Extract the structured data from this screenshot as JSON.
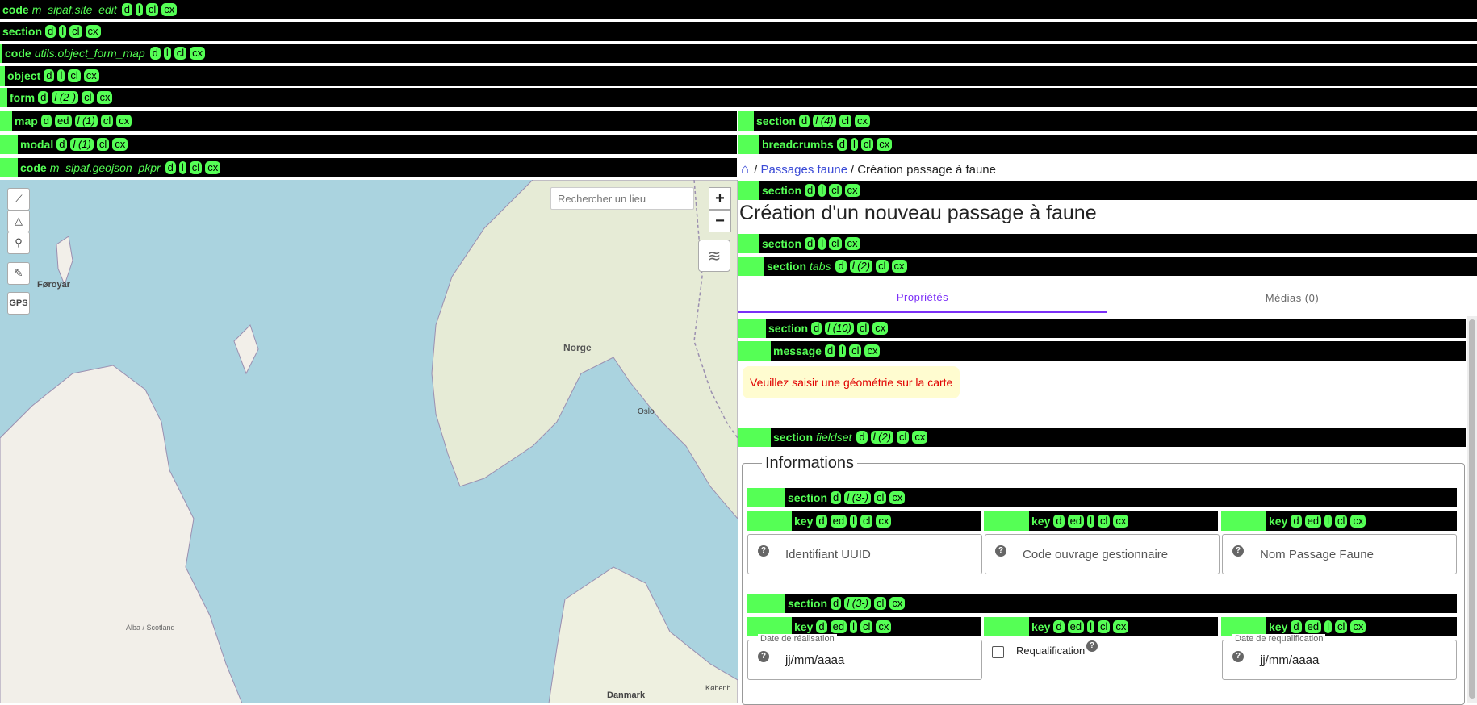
{
  "bars": {
    "code_site": {
      "tag": "code",
      "name": "m_sipaf.site_edit",
      "pills": [
        "d",
        "l",
        "cl",
        "cx"
      ]
    },
    "section1": {
      "tag": "section",
      "name": "",
      "pills": [
        "d",
        "l",
        "cl",
        "cx"
      ]
    },
    "code_utils": {
      "tag": "code",
      "name": "utils.object_form_map",
      "pills": [
        "d",
        "l",
        "cl",
        "cx"
      ]
    },
    "object": {
      "tag": "object",
      "name": "",
      "pills": [
        "d",
        "l",
        "cl",
        "cx"
      ]
    },
    "form": {
      "tag": "form",
      "name": "",
      "pills": [
        "d",
        "l (2-)",
        "cl",
        "cx"
      ]
    },
    "map": {
      "tag": "map",
      "name": "",
      "pills": [
        "d",
        "ed",
        "l (1)",
        "cl",
        "cx"
      ]
    },
    "modal": {
      "tag": "modal",
      "name": "",
      "pills": [
        "d",
        "l (1)",
        "cl",
        "cx"
      ]
    },
    "code_geojson": {
      "tag": "code",
      "name": "m_sipaf.geojson_pkpr",
      "pills": [
        "d",
        "l",
        "cl",
        "cx"
      ]
    },
    "section_right": {
      "tag": "section",
      "name": "",
      "pills": [
        "d",
        "l (4)",
        "cl",
        "cx"
      ]
    },
    "breadcrumbs": {
      "tag": "breadcrumbs",
      "name": "",
      "pills": [
        "d",
        "l",
        "cl",
        "cx"
      ]
    },
    "section_title": {
      "tag": "section",
      "name": "",
      "pills": [
        "d",
        "l",
        "cl",
        "cx"
      ]
    },
    "section_tabs_wrap": {
      "tag": "section",
      "name": "",
      "pills": [
        "d",
        "l",
        "cl",
        "cx"
      ]
    },
    "section_tabs": {
      "tag": "section",
      "name": "tabs",
      "pills": [
        "d",
        "l (2)",
        "cl",
        "cx"
      ]
    },
    "section_10": {
      "tag": "section",
      "name": "",
      "pills": [
        "d",
        "l (10)",
        "cl",
        "cx"
      ]
    },
    "message": {
      "tag": "message",
      "name": "",
      "pills": [
        "d",
        "l",
        "cl",
        "cx"
      ]
    },
    "section_fieldset": {
      "tag": "section",
      "name": "fieldset",
      "pills": [
        "d",
        "l (2)",
        "cl",
        "cx"
      ]
    },
    "section_row1": {
      "tag": "section",
      "name": "",
      "pills": [
        "d",
        "l (3-)",
        "cl",
        "cx"
      ]
    },
    "key_r1_1": {
      "tag": "key",
      "name": "",
      "pills": [
        "d",
        "ed",
        "l",
        "cl",
        "cx"
      ]
    },
    "key_r1_2": {
      "tag": "key",
      "name": "",
      "pills": [
        "d",
        "ed",
        "l",
        "cl",
        "cx"
      ]
    },
    "key_r1_3": {
      "tag": "key",
      "name": "",
      "pills": [
        "d",
        "ed",
        "l",
        "cl",
        "cx"
      ]
    },
    "section_row2": {
      "tag": "section",
      "name": "",
      "pills": [
        "d",
        "l (3-)",
        "cl",
        "cx"
      ]
    },
    "key_r2_1": {
      "tag": "key",
      "name": "",
      "pills": [
        "d",
        "ed",
        "l",
        "cl",
        "cx"
      ]
    },
    "key_r2_2": {
      "tag": "key",
      "name": "",
      "pills": [
        "d",
        "ed",
        "l",
        "cl",
        "cx"
      ]
    },
    "key_r2_3": {
      "tag": "key",
      "name": "",
      "pills": [
        "d",
        "ed",
        "l",
        "cl",
        "cx"
      ]
    }
  },
  "map": {
    "search_placeholder": "Rechercher un lieu",
    "zoom_in": "+",
    "zoom_out": "−",
    "gps_label": "GPS",
    "labels": {
      "foroyar": "Føroyar",
      "norge": "Norge",
      "oslo": "Oslo",
      "scotland": "Alba / Scotland",
      "danmark": "Danmark",
      "kobenhavn": "Københ"
    }
  },
  "breadcrumb": {
    "link": "Passages faune",
    "separator": "/",
    "current": "Création passage à faune"
  },
  "page_title": "Création d'un nouveau passage à faune",
  "tabs": [
    {
      "label": "Propriétés",
      "active": true
    },
    {
      "label": "Médias (0)",
      "active": false
    }
  ],
  "alert": "Veuillez saisir une géométrie sur la carte",
  "fieldset_legend": "Informations",
  "fields_row1": [
    {
      "placeholder": "Identifiant UUID"
    },
    {
      "placeholder": "Code ouvrage gestionnaire"
    },
    {
      "placeholder": "Nom Passage Faune"
    }
  ],
  "fields_row2": {
    "date_realisation": {
      "legend": "Date de réalisation",
      "value": "jj/mm/aaaa"
    },
    "requalification": {
      "label": "Requalification",
      "checked": false
    },
    "date_requalification": {
      "legend": "Date de requalification",
      "value": "jj/mm/aaaa"
    }
  },
  "colors": {
    "tag_green": "#55ff55",
    "accent": "#7b2ff7",
    "link": "#3b4bd6",
    "alert_text": "#e00000",
    "alert_bg": "#fffcd0",
    "water": "#aad3df",
    "land": "#f2efe9"
  }
}
